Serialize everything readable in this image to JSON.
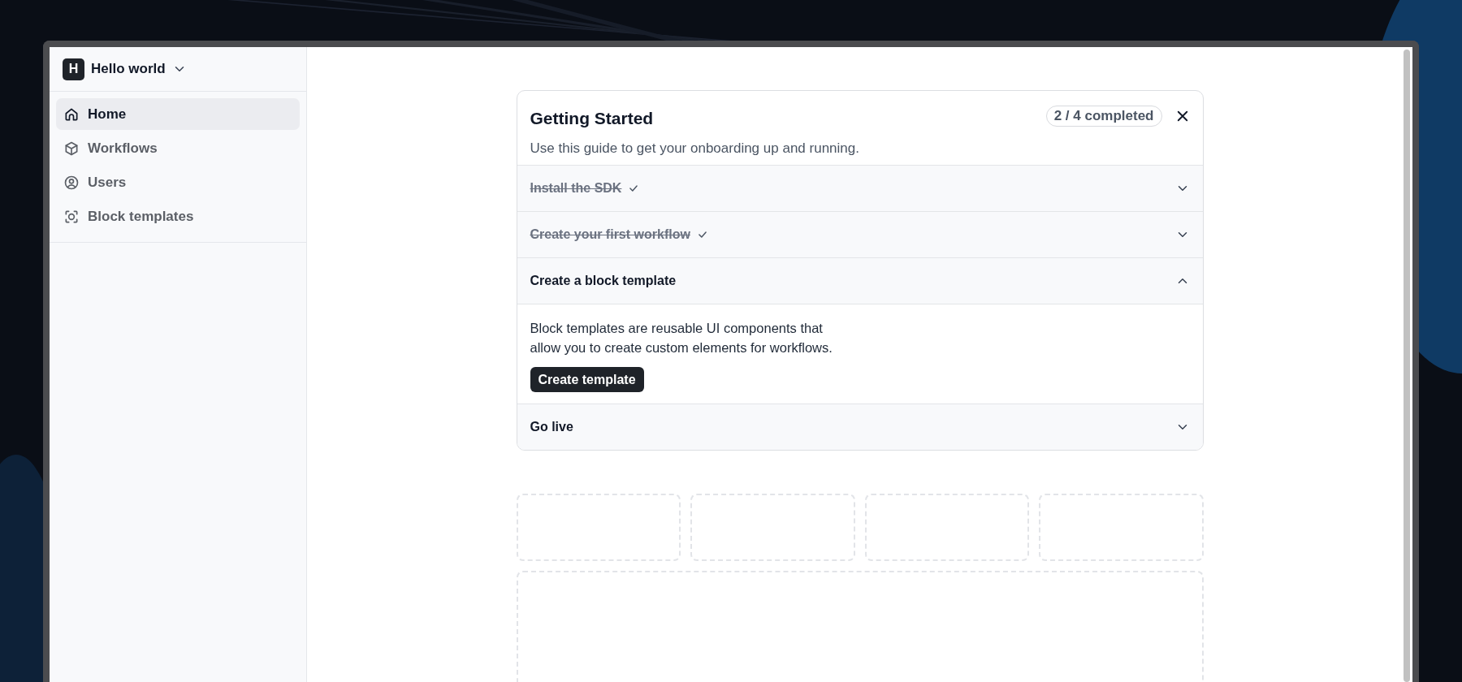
{
  "workspace": {
    "initial": "H",
    "name": "Hello world"
  },
  "nav": [
    {
      "label": "Home",
      "selected": true
    },
    {
      "label": "Workflows",
      "selected": false
    },
    {
      "label": "Users",
      "selected": false
    },
    {
      "label": "Block templates",
      "selected": false
    }
  ],
  "guide": {
    "title": "Getting Started",
    "subtitle": "Use this guide to get your onboarding up and running.",
    "progress": "2 / 4 completed",
    "steps": [
      {
        "title": "Install the SDK",
        "completed": true,
        "expanded": false
      },
      {
        "title": "Create your first workflow",
        "completed": true,
        "expanded": false
      },
      {
        "title": "Create a block template",
        "completed": false,
        "expanded": true,
        "body": "Block templates are reusable UI components that allow you to create custom elements for workflows.",
        "action": "Create template"
      },
      {
        "title": "Go live",
        "completed": false,
        "expanded": false
      }
    ]
  }
}
